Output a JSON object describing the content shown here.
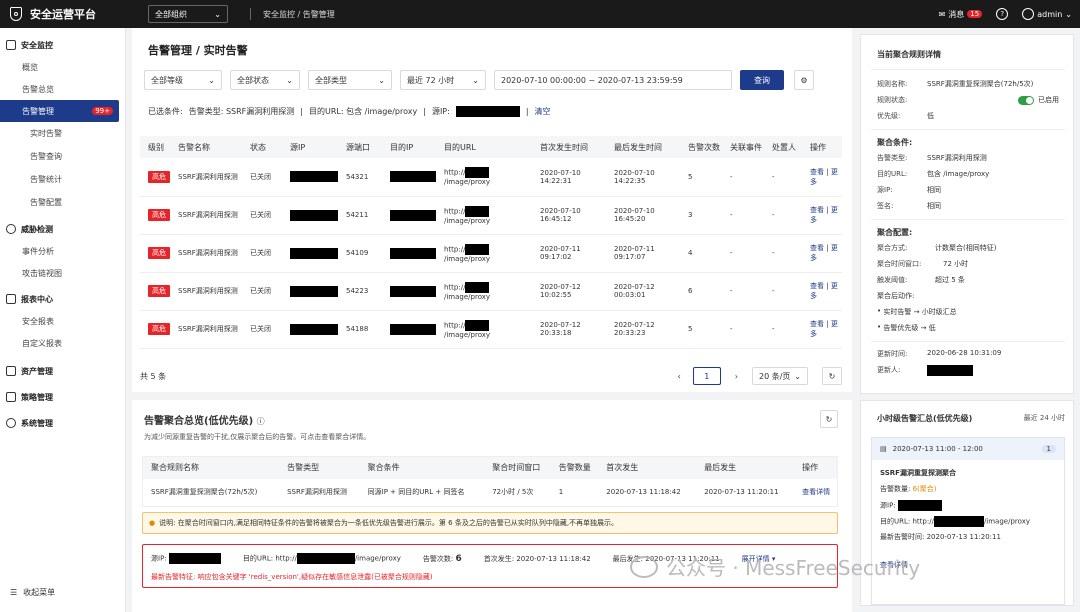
{
  "topbar": {
    "title": "安全运营平台",
    "org": "全部组织",
    "crumb": "安全监控 / 告警管理",
    "messages": "消息",
    "msg_count": "15",
    "user": "admin"
  },
  "sidebar": {
    "g1": "安全监控",
    "g1_items": [
      "概览",
      "告警总览"
    ],
    "active": "告警管理",
    "active_badge": "99+",
    "g1_sub": [
      "实时告警",
      "告警查询",
      "告警统计",
      "告警配置"
    ],
    "g2": "威胁检测",
    "g2_items": [
      "事件分析",
      "攻击链视图"
    ],
    "g3": "报表中心",
    "g3_items": [
      "安全报表",
      "自定义报表"
    ],
    "g4": "资产管理",
    "g5": "策略管理",
    "g6": "系统管理",
    "collapse": "收起菜单"
  },
  "page": {
    "title": "告警管理 / 实时告警"
  },
  "filters": {
    "level": "全部等级",
    "status": "全部状态",
    "type": "全部类型",
    "time": "最近 72 小时",
    "range": "2020-07-10 00:00:00 ~ 2020-07-13 23:59:59",
    "query": "查询"
  },
  "chips": {
    "label": "已选条件:",
    "type": "告警类型: SSRF漏洞利用探测",
    "url": "目的URL: 包含 /image/proxy",
    "src": "源IP:",
    "clear": "清空"
  },
  "table": {
    "headers": [
      "级别",
      "告警名称",
      "状态",
      "源IP",
      "源端口",
      "目的IP",
      "目的URL",
      "首次发生时间",
      "最后发生时间",
      "告警次数",
      "关联事件",
      "处置人",
      "操作"
    ],
    "rows": [
      {
        "level": "高危",
        "name": "SSRF漏洞利用探测",
        "status": "已关闭",
        "port": "54321",
        "url_a": "http://",
        "url_b": "/image/proxy",
        "first": "2020-07-10 14:22:31",
        "last": "2020-07-10 14:22:35",
        "count": "5",
        "rel": "-",
        "owner": "-",
        "view": "查看",
        "more": "更多"
      },
      {
        "level": "高危",
        "name": "SSRF漏洞利用探测",
        "status": "已关闭",
        "port": "54211",
        "url_a": "http://",
        "url_b": "/image/proxy",
        "first": "2020-07-10 16:45:12",
        "last": "2020-07-10 16:45:20",
        "count": "3",
        "rel": "-",
        "owner": "-",
        "view": "查看",
        "more": "更多"
      },
      {
        "level": "高危",
        "name": "SSRF漏洞利用探测",
        "status": "已关闭",
        "port": "54109",
        "url_a": "http://",
        "url_b": "/image/proxy",
        "first": "2020-07-11 09:17:02",
        "last": "2020-07-11 09:17:07",
        "count": "4",
        "rel": "-",
        "owner": "-",
        "view": "查看",
        "more": "更多"
      },
      {
        "level": "高危",
        "name": "SSRF漏洞利用探测",
        "status": "已关闭",
        "port": "54223",
        "url_a": "http://",
        "url_b": "/image/proxy",
        "first": "2020-07-12 10:02:55",
        "last": "2020-07-12 00:03:01",
        "count": "6",
        "rel": "-",
        "owner": "-",
        "view": "查看",
        "more": "更多"
      },
      {
        "level": "高危",
        "name": "SSRF漏洞利用探测",
        "status": "已关闭",
        "port": "54188",
        "url_a": "http://",
        "url_b": "/image/proxy",
        "first": "2020-07-12 20:33:18",
        "last": "2020-07-12 20:33:23",
        "count": "5",
        "rel": "-",
        "owner": "-",
        "view": "查看",
        "more": "更多"
      }
    ]
  },
  "pager": {
    "total": "共 5 条",
    "page": "1",
    "size": "20 条/页"
  },
  "agg": {
    "title": "告警聚合总览(低优先级)",
    "desc": "为减少同源重复告警的干扰,仅展示聚合后的告警。可点击查看聚合详情。",
    "headers": [
      "聚合规则名称",
      "告警类型",
      "聚合条件",
      "聚合时间窗口",
      "告警数量",
      "首次发生",
      "最后发生",
      "操作"
    ],
    "row": [
      "SSRF漏洞重复探测聚合(72h/5次)",
      "SSRF漏洞利用探测",
      "同源IP + 同目的URL + 同签名",
      "72小时 / 5次",
      "1",
      "2020-07-13 11:18:42",
      "2020-07-13 11:20:11",
      "查看详情"
    ],
    "warn": "说明: 在聚合时间窗口内,满足相同特征条件的告警将被聚合为一条低优先级告警进行展示。第 6 条及之后的告警已从实时队列中隐藏,不再单独展示。",
    "d_src": "源IP:",
    "d_url": "目的URL:",
    "d_url_a": "http://",
    "d_url_b": "/image/proxy",
    "d_cnt": "告警次数:",
    "d_cnt_v": "6",
    "d_first": "首次发生: 2020-07-13 11:18:42",
    "d_last": "最后发生: 2020-07-13 11:20:11",
    "d_expand": "展开详情 ▾",
    "d_feature": "最新告警特征: 响应包含关键字 'redis_version',疑似存在敏感信息泄露(已被聚合规则隐藏)"
  },
  "rule": {
    "title": "当前聚合规则详情",
    "name_k": "规则名称:",
    "name_v": "SSRF漏洞重复探测聚合(72h/5次)",
    "status_k": "规则状态:",
    "status_v": "已启用",
    "prio_k": "优先级:",
    "prio_v": "低",
    "cond_t": "聚合条件:",
    "c1_k": "告警类型:",
    "c1_v": "SSRF漏洞利用探测",
    "c2_k": "目的URL:",
    "c2_v": "包含 /image/proxy",
    "c3_k": "源IP:",
    "c3_v": "相同",
    "c4_k": "签名:",
    "c4_v": "相同",
    "conf_t": "聚合配置:",
    "m_k": "聚合方式:",
    "m_v": "计数聚合(相同特征)",
    "w_k": "聚合时间窗口:",
    "w_v": "72 小时",
    "t_k": "触发阈值:",
    "t_v": "超过 5 条",
    "act_t": "聚合后动作:",
    "a1": "实时告警 → 小时级汇总",
    "a2": "告警优先级 → 低",
    "up_k": "更新时间:",
    "up_v": "2020-06-28 10:31:09",
    "by_k": "更新人:"
  },
  "hourly": {
    "title": "小时级告警汇总(低优先级)",
    "range": "最近 24 小时",
    "slot": "2020-07-13 11:00 - 12:00",
    "slot_cnt": "1",
    "name": "SSRF漏洞重复探测聚合",
    "cnt_k": "告警数量:",
    "cnt_v": "6(聚合)",
    "src_k": "源IP:",
    "url_k": "目的URL:",
    "url_a": "http://",
    "url_b": "/image/proxy",
    "last_k": "最新告警时间:",
    "last_v": "2020-07-13 11:20:11",
    "view": "查看详情"
  },
  "watermark": "公众号 · MessFreeSecurity"
}
